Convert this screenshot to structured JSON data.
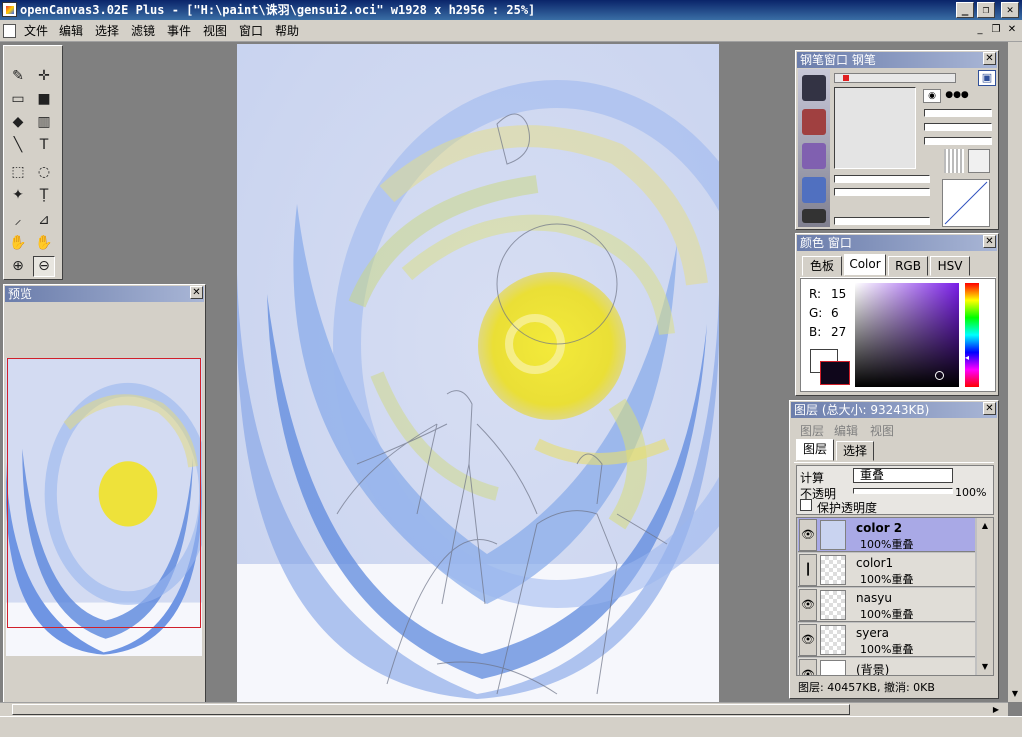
{
  "window": {
    "title": "openCanvas3.02E Plus - [\"H:\\paint\\诛羽\\gensui2.oci\" w1928 x h2956 : 25%]"
  },
  "menu": [
    "文件",
    "编辑",
    "选择",
    "滤镜",
    "事件",
    "视图",
    "窗口",
    "帮助"
  ],
  "tools": [
    {
      "name": "pen-icon",
      "glyph": "✎"
    },
    {
      "name": "move-icon",
      "glyph": "✛"
    },
    {
      "name": "rect-select-icon",
      "glyph": "▭"
    },
    {
      "name": "fill-rect-icon",
      "glyph": "■"
    },
    {
      "name": "bucket-icon",
      "glyph": "◆"
    },
    {
      "name": "gradient-icon",
      "glyph": "▥"
    },
    {
      "name": "line-icon",
      "glyph": "╲"
    },
    {
      "name": "text-icon",
      "glyph": "T"
    },
    {
      "name": "marquee-icon",
      "glyph": "⬚"
    },
    {
      "name": "lasso-icon",
      "glyph": "◌"
    },
    {
      "name": "magic-wand-icon",
      "glyph": "✦"
    },
    {
      "name": "text-mask-icon",
      "glyph": "Ṭ"
    },
    {
      "name": "eyedropper-icon",
      "glyph": "⸝"
    },
    {
      "name": "crop-icon",
      "glyph": "⊿"
    },
    {
      "name": "hand-icon",
      "glyph": "✋"
    },
    {
      "name": "rotate-hand-icon",
      "glyph": "✋"
    },
    {
      "name": "zoom-in-icon",
      "glyph": "⊕"
    },
    {
      "name": "zoom-out-icon",
      "glyph": "⊖"
    }
  ],
  "preview": {
    "title": "预览"
  },
  "brush_panel": {
    "title": "钢笔窗口  钢笔"
  },
  "color_panel": {
    "title": "颜色 窗口",
    "tabs": [
      "色板",
      "Color",
      "RGB",
      "HSV"
    ],
    "selected_tab": "Color",
    "r_label": "R:",
    "r_value": "15",
    "g_label": "G:",
    "g_value": "6",
    "b_label": "B:",
    "b_value": "27",
    "fg_color": "#0f061b",
    "bg_color": "#ffffff"
  },
  "layer_panel": {
    "title": "图层 (总大小: 93243KB)",
    "menu": [
      "图层",
      "编辑",
      "视图"
    ],
    "tabs": [
      "图层",
      "选择"
    ],
    "blend_label": "计算",
    "blend_value": "重叠",
    "opacity_label": "不透明",
    "opacity_value": "100%",
    "protect_label": "保护透明度",
    "layers": [
      {
        "name": "color 2",
        "mode": "100%重叠",
        "selected": true
      },
      {
        "name": "color1",
        "mode": "100%重叠",
        "selected": false
      },
      {
        "name": "nasyu",
        "mode": "100%重叠",
        "selected": false
      },
      {
        "name": "syera",
        "mode": "100%重叠",
        "selected": false
      },
      {
        "name": "(背景)",
        "mode": "",
        "selected": false
      }
    ],
    "status": "图层: 40457KB, 撤消: 0KB"
  },
  "colors": {
    "title_active": "#0a246a",
    "panel_title": "#6b7dab",
    "selected_layer": "#a9a9e6"
  }
}
